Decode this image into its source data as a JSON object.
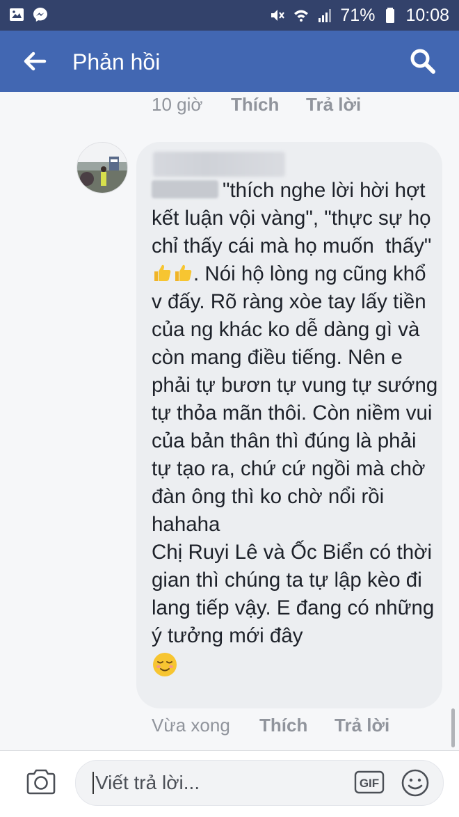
{
  "status_bar": {
    "battery": "71%",
    "time": "10:08",
    "left_icons": [
      "gallery-icon",
      "messenger-icon"
    ],
    "right_icons": [
      "mute-icon",
      "wifi-icon",
      "signal-icon",
      "battery-icon"
    ]
  },
  "app_bar": {
    "title": "Phản hồi",
    "back_icon": "arrow-left-icon",
    "search_icon": "search-icon",
    "background": "#4267b2"
  },
  "previous_comment_actions": {
    "time": "10 giờ",
    "like_label": "Thích",
    "reply_label": "Trả lời"
  },
  "comment": {
    "author": "",
    "text_line1": "\"thích nghe lời hời hợt kết luận vội vàng\", \"thực sự họ chỉ thấy cái mà họ muốn  thấy\" ",
    "text_line2": ". Nói hộ lòng ng cũng khổ v đấy. Rõ ràng xòe tay lấy tiền của ng khác ko dễ dàng gì và còn mang điều tiếng. Nên e phải tự bươn tự vung tự sướng tự thỏa mãn thôi. Còn niềm vui của bản thân thì đúng là phải tự tạo ra, chứ cứ ngồi mà chờ đàn ông thì ko chờ nổi rồi hahaha\nChị Ruyi Lê và Ốc Biển có thời gian thì chúng ta tự lập kèo đi lang tiếp vậy. E đang có những ý tưởng mới đây",
    "inline_emoji": "thumbs-up-icon",
    "end_emoji": "relieved-face-icon",
    "bubble_color": "#eceef1"
  },
  "comment_actions": {
    "time": "Vừa xong",
    "like_label": "Thích",
    "reply_label": "Trả lời"
  },
  "composer": {
    "placeholder": "Viết trả lời...",
    "camera_icon": "camera-icon",
    "gif_label": "GIF",
    "emoji_icon": "smiley-icon"
  }
}
